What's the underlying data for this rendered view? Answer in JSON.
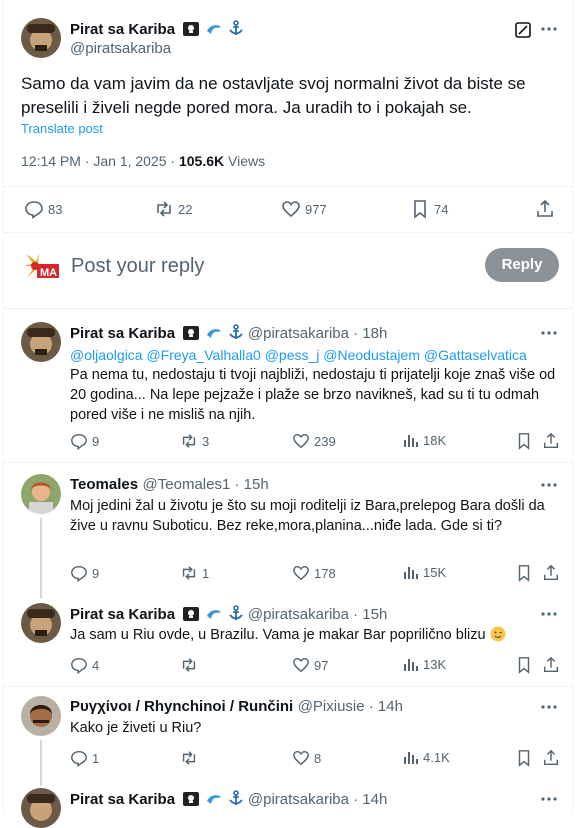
{
  "main_post": {
    "author_name": "Pirat sa Kariba",
    "author_handle": "@piratsakariba",
    "text": "Samo da vam javim da ne ostavljate svoj normalni život da biste se preselili i živeli negde pored mora. Ja uradih to i pokajah se.",
    "translate_label": "Translate post",
    "time": "12:14 PM · Jan 1, 2025 · ",
    "views_count": "105.6K",
    "views_label": " Views",
    "replies": "83",
    "reposts": "22",
    "likes": "977",
    "bookmarks": "74"
  },
  "composer": {
    "placeholder": "Post your reply",
    "reply_button": "Reply"
  },
  "replies": [
    {
      "author_name": "Pirat sa Kariba",
      "author_handle": "@piratsakariba · 18h",
      "mentions": "@oljaolgica @Freya_Valhalla0 @pess_j @Neodustajem @Gattaselvatica",
      "text": "Pa nema tu, nedostaju ti tvoji najbliži, nedostaju ti prijatelji koje znaš više od 20 godina... Na lepe pejzaže i plaže se brzo navikneš, kad su ti tu odmah pored više i ne misliš na njih.",
      "replies": "9",
      "reposts": "3",
      "likes": "239",
      "views": "18K"
    },
    {
      "author_name": "Teomales",
      "author_handle": "@Teomales1 · 15h",
      "text": "Moj jedini žal u životu je što su moji roditelji iz Bara,prelepog Bara došli da žive u ravnu Suboticu. Bez reke,mora,planina...niđe lada. Gde si ti?",
      "replies": "9",
      "reposts": "1",
      "likes": "178",
      "views": "15K"
    },
    {
      "author_name": "Pirat sa Kariba",
      "author_handle": "@piratsakariba · 15h",
      "text": "Ja sam u Riu ovde, u Brazilu. Vama je makar Bar popriličnо blizu",
      "replies": "4",
      "reposts": "",
      "likes": "97",
      "views": "13K"
    },
    {
      "author_name": "Ρυγχίνοι / Rhynchinoi / Runčini",
      "author_handle": "@Pixiusie · 14h",
      "text": "Kako je živeti u Riu?",
      "replies": "1",
      "reposts": "",
      "likes": "8",
      "views": "4.1K"
    },
    {
      "author_name": "Pirat sa Kariba",
      "author_handle": "@piratsakariba · 14h"
    }
  ],
  "icons": {
    "more": "more-dots-icon",
    "grok": "grok-icon",
    "reply": "reply-icon",
    "repost": "repost-icon",
    "like": "heart-icon",
    "views": "views-icon",
    "bookmark": "bookmark-icon",
    "share": "share-icon"
  },
  "colors": {
    "link": "#1d9bf0",
    "muted": "#536471",
    "reply_button": "#8b9398"
  }
}
